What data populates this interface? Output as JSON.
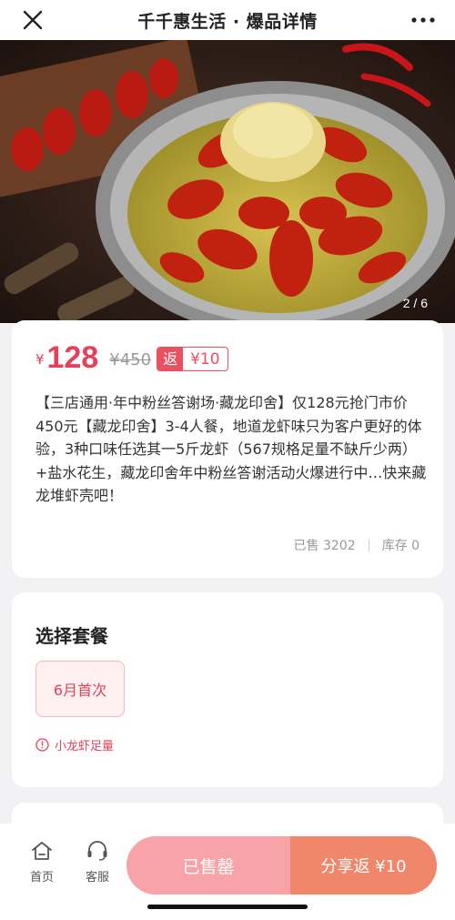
{
  "header": {
    "title": "千千惠生活 · 爆品详情"
  },
  "hero": {
    "pager": "2 / 6"
  },
  "product": {
    "currency": "¥",
    "price": "128",
    "original_price": "¥450",
    "rebate_tag": "返",
    "rebate_amount": "¥10",
    "description": "【三店通用·年中粉丝答谢场·藏龙印舍】仅128元抢门市价450元【藏龙印舍】3-4人餐，地道龙虾味只为客户更好的体验，3种口味任选其一5斤龙虾（567规格足量不缺斤少两）+盐水花生，藏龙印舍年中粉丝答谢活动火爆进行中…快来藏龙堆虾壳吧！",
    "sold": "已售 3202",
    "stock": "库存 0"
  },
  "package": {
    "title": "选择套餐",
    "option": "6月首次",
    "note": "小龙虾足量"
  },
  "bottom": {
    "home": "首页",
    "service": "客服",
    "soldout": "已售罄",
    "share": "分享返 ¥10"
  },
  "colors": {
    "accent": "#e6415a",
    "soldout_bg": "#f7a3a8",
    "share_bg": "#f0866a"
  },
  "icons": {
    "close": "close-icon",
    "more": "more-icon",
    "home": "home-icon",
    "service": "headset-icon",
    "alert": "alert-circle-icon"
  }
}
